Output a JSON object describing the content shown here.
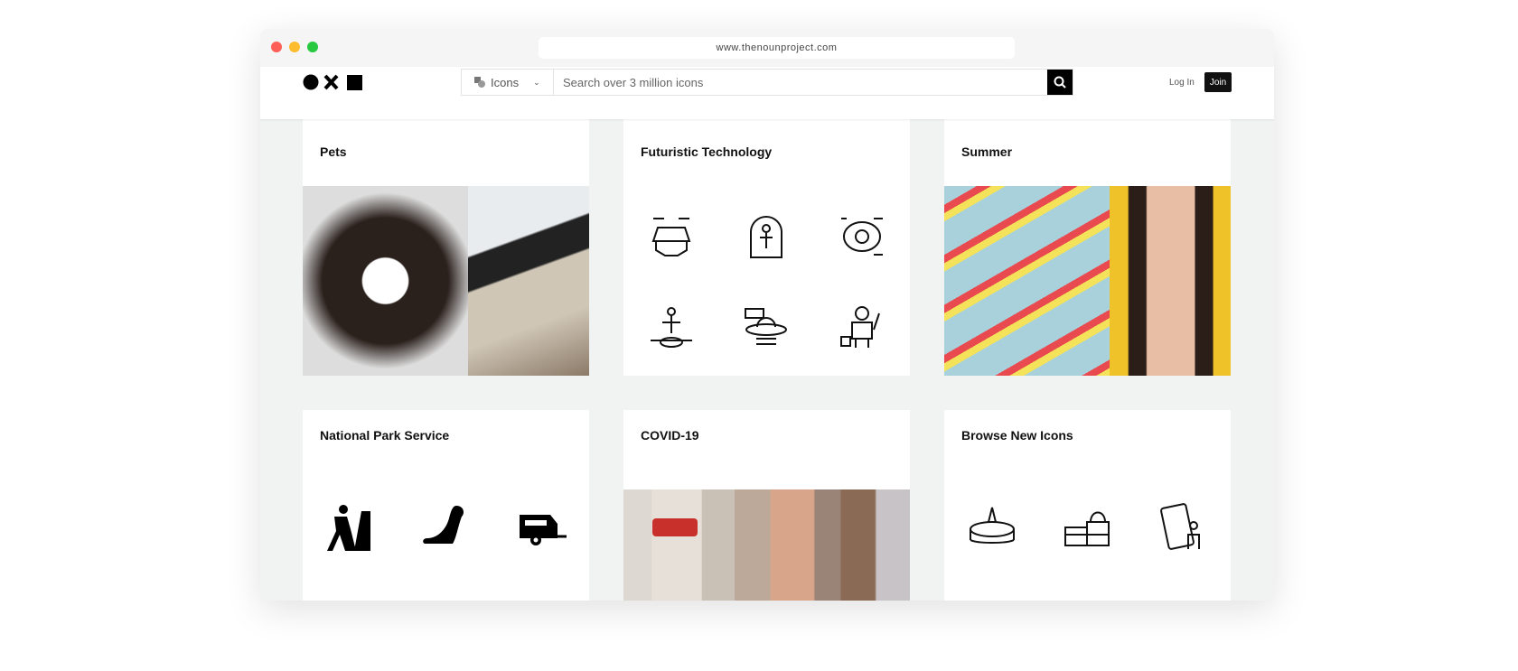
{
  "browser": {
    "url": "www.thenounproject.com"
  },
  "header": {
    "search_type": "Icons",
    "search_placeholder": "Search over 3 million icons",
    "login": "Log In",
    "join": "Join"
  },
  "cards": [
    {
      "title": "Pets"
    },
    {
      "title": "Futuristic Technology"
    },
    {
      "title": "Summer"
    },
    {
      "title": "National Park Service"
    },
    {
      "title": "COVID-19"
    },
    {
      "title": "Browse New Icons"
    }
  ],
  "colors": {
    "background": "#f1f2f2",
    "accent": "#000000"
  }
}
